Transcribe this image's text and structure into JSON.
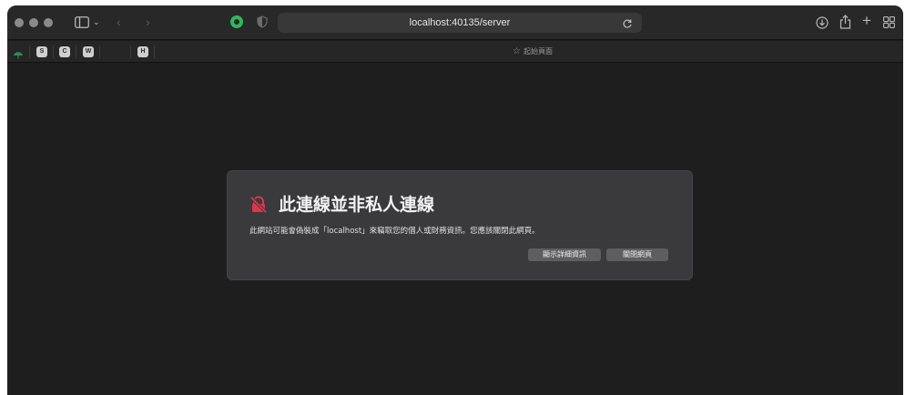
{
  "browser": {
    "address_url": "localhost:40135/server",
    "start_page_label": "起始頁面",
    "favorites": [
      "S",
      "C",
      "W",
      "H"
    ],
    "accent_colors": {
      "extension": "#2fb85a",
      "warning": "#e0344b",
      "tab_leaf": "#2e8b57"
    }
  },
  "dialog": {
    "title": "此連線並非私人連線",
    "message": "此網站可能會偽裝成「localhost」來竊取您的個人或財務資訊。您應該關閉此網頁。",
    "details_button": "顯示詳細資訊",
    "close_button": "關閉網頁",
    "icon": "not-secure-lock-icon"
  }
}
